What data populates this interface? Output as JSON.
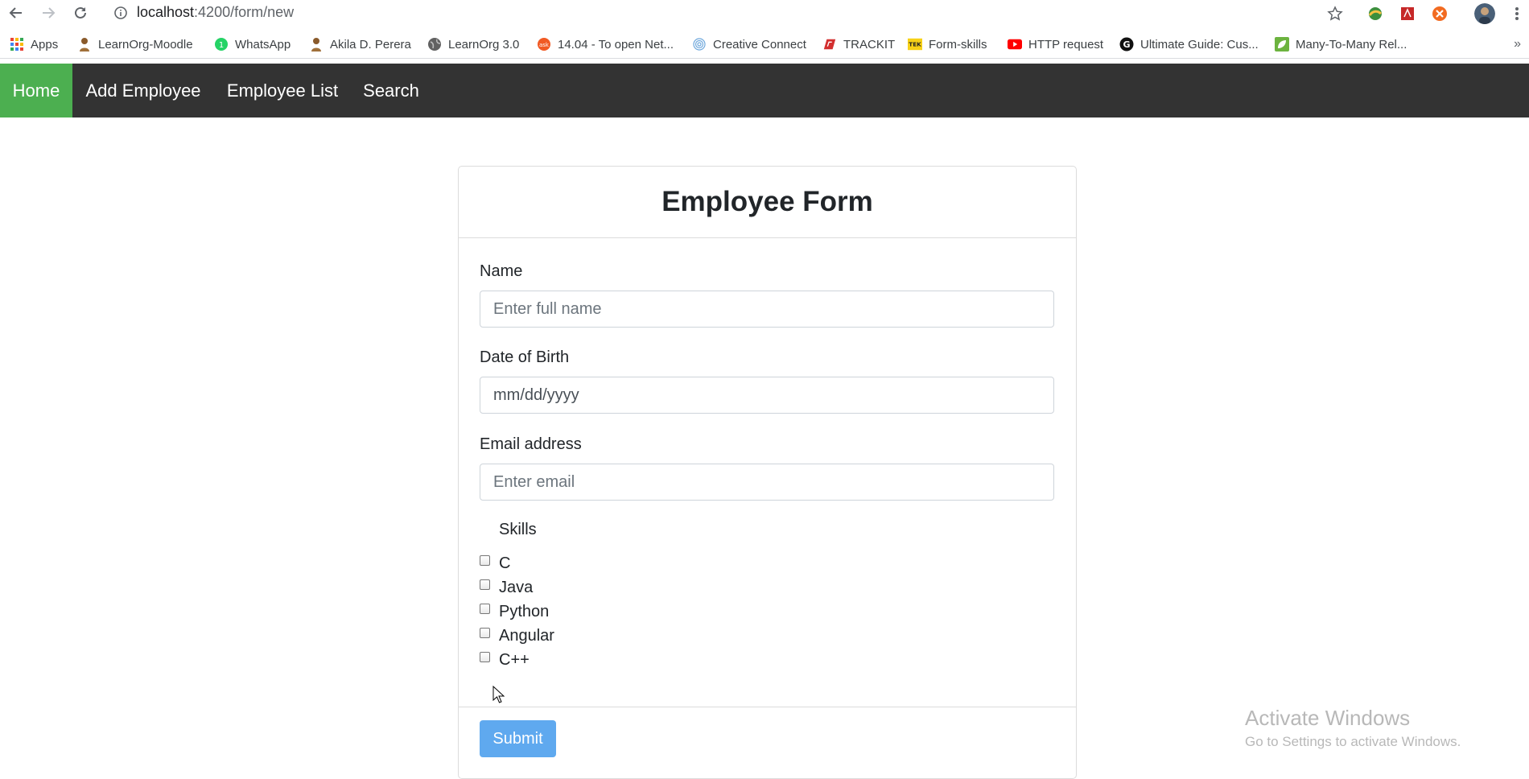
{
  "browser": {
    "url_host": "localhost",
    "url_path": ":4200/form/new",
    "bookmarks": [
      {
        "label": "Apps",
        "icon": "apps-grid-icon"
      },
      {
        "label": "LearnOrg-Moodle",
        "icon": "moodle-icon"
      },
      {
        "label": "WhatsApp",
        "icon": "whatsapp-icon"
      },
      {
        "label": "Akila D. Perera",
        "icon": "person-icon"
      },
      {
        "label": "LearnOrg 3.0",
        "icon": "globe-icon"
      },
      {
        "label": "14.04 - To open Net...",
        "icon": "askubuntu-icon"
      },
      {
        "label": "Creative Connect",
        "icon": "fingerprint-icon"
      },
      {
        "label": "TRACKIT",
        "icon": "trackit-icon"
      },
      {
        "label": "Form-skills",
        "icon": "tek-icon"
      },
      {
        "label": "HTTP request",
        "icon": "youtube-icon"
      },
      {
        "label": "Ultimate Guide: Cus...",
        "icon": "g-icon"
      },
      {
        "label": "Many-To-Many Rel...",
        "icon": "leaf-icon"
      }
    ],
    "more": "»"
  },
  "nav": {
    "items": [
      "Home",
      "Add Employee",
      "Employee List",
      "Search"
    ],
    "active": "Home"
  },
  "form": {
    "title": "Employee Form",
    "name_label": "Name",
    "name_placeholder": "Enter full name",
    "dob_label": "Date of Birth",
    "dob_placeholder": "mm/dd/yyyy",
    "email_label": "Email address",
    "email_placeholder": "Enter email",
    "skills_label": "Skills",
    "skills": [
      "C",
      "Java",
      "Python",
      "Angular",
      "C++"
    ],
    "submit_label": "Submit"
  },
  "watermark": {
    "title": "Activate Windows",
    "subtitle": "Go to Settings to activate Windows."
  },
  "colors": {
    "nav_bg": "#333333",
    "nav_active": "#4caf50",
    "submit_bg": "#5fa9ef"
  }
}
